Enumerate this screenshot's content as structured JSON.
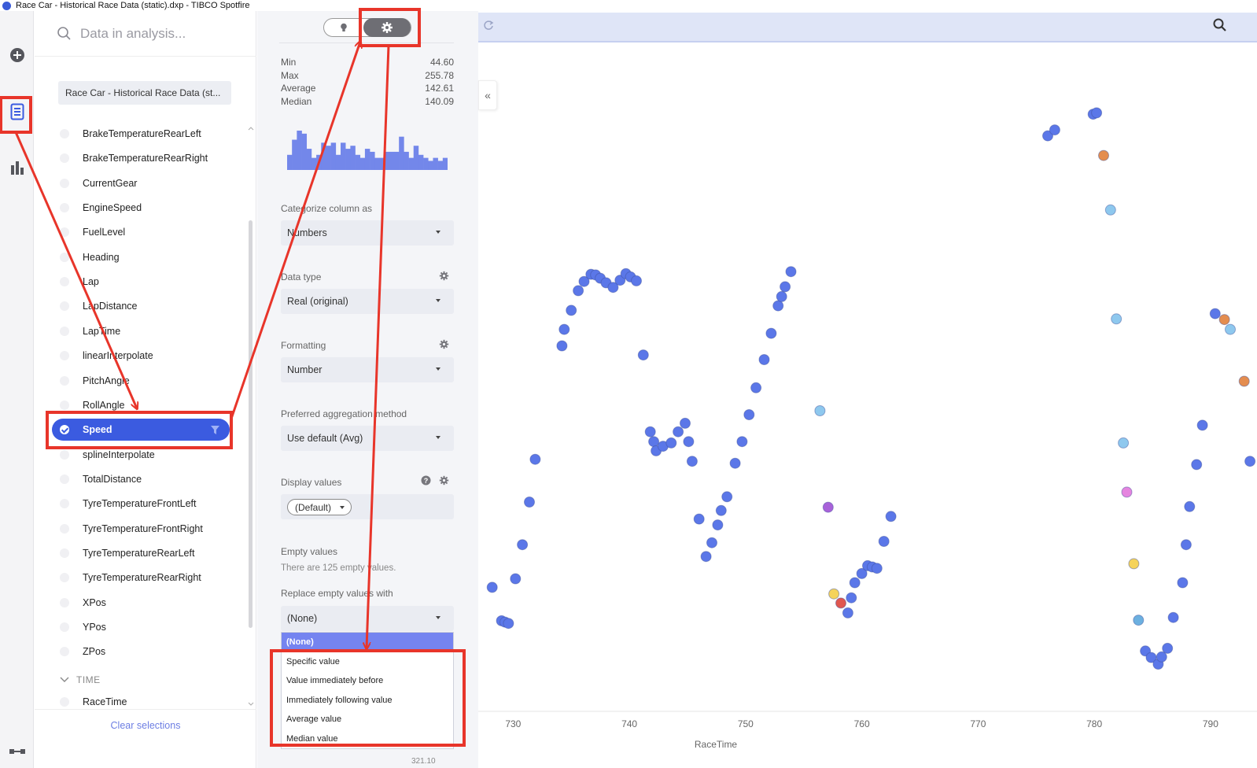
{
  "window": {
    "title": "Race Car - Historical Race Data (static).dxp - TIBCO Spotfire"
  },
  "rail": {
    "icons": [
      "add-icon",
      "data-icon",
      "visualization-icon",
      "bookmark-icon"
    ]
  },
  "data_panel": {
    "search_placeholder": "Data in analysis...",
    "data_source": "Race Car - Historical Race Data (st...",
    "columns": [
      {
        "label": "BrakeTemperatureRearLeft"
      },
      {
        "label": "BrakeTemperatureRearRight"
      },
      {
        "label": "CurrentGear"
      },
      {
        "label": "EngineSpeed"
      },
      {
        "label": "FuelLevel"
      },
      {
        "label": "Heading"
      },
      {
        "label": "Lap"
      },
      {
        "label": "LapDistance"
      },
      {
        "label": "LapTime"
      },
      {
        "label": "linearInterpolate"
      },
      {
        "label": "PitchAngle"
      },
      {
        "label": "RollAngle"
      },
      {
        "label": "Speed"
      },
      {
        "label": "splineInterpolate"
      },
      {
        "label": "TotalDistance"
      },
      {
        "label": "TyreTemperatureFrontLeft"
      },
      {
        "label": "TyreTemperatureFrontRight"
      },
      {
        "label": "TyreTemperatureRearLeft"
      },
      {
        "label": "TyreTemperatureRearRight"
      },
      {
        "label": "XPos"
      },
      {
        "label": "YPos"
      },
      {
        "label": "ZPos"
      }
    ],
    "selected_column": "Speed",
    "group_header": "TIME",
    "time_column": "RaceTime",
    "clear_selections": "Clear selections"
  },
  "settings_panel": {
    "stats": [
      {
        "label": "Min",
        "value": "44.60"
      },
      {
        "label": "Max",
        "value": "255.78"
      },
      {
        "label": "Average",
        "value": "142.61"
      },
      {
        "label": "Median",
        "value": "140.09"
      }
    ],
    "histogram_counts": [
      5,
      10,
      13,
      12,
      7,
      4,
      5,
      9,
      8,
      9,
      5,
      9,
      7,
      8,
      5,
      4,
      7,
      6,
      4,
      4,
      6,
      6,
      6,
      11,
      6,
      4,
      8,
      5,
      4,
      3,
      4,
      3,
      4
    ],
    "categorize_label": "Categorize column as",
    "categorize_value": "Numbers",
    "data_type_label": "Data type",
    "data_type_value": "Real (original)",
    "formatting_label": "Formatting",
    "formatting_value": "Number",
    "aggregation_label": "Preferred aggregation method",
    "aggregation_value": "Use default (Avg)",
    "display_values_label": "Display values",
    "display_values_value": "(Default)",
    "empty_values_label": "Empty values",
    "empty_values_note": "There are 125 empty values.",
    "replace_label": "Replace empty values with",
    "replace_value": "(None)",
    "replace_options": [
      "(None)",
      "Specific value",
      "Value immediately before",
      "Immediately following value",
      "Average value",
      "Median value"
    ],
    "bottom_partial": "321.10"
  },
  "chart_data": {
    "type": "scatter",
    "xlabel": "RaceTime",
    "ylabel": "",
    "xlim": [
      727,
      794
    ],
    "ylim": [
      0,
      100
    ],
    "xticks": [
      730,
      740,
      750,
      760,
      770,
      780,
      790
    ],
    "colors": {
      "primary": "#5b77e8",
      "lightblue": "#8ec8ee",
      "orange": "#e48d4f",
      "yellow": "#f5d35a",
      "red": "#e0574f",
      "purple": "#a862d9",
      "pink": "#e585df",
      "teal": "#6cb0e0"
    },
    "points": [
      {
        "x": 728.2,
        "y": 18.9,
        "c": "primary"
      },
      {
        "x": 729.0,
        "y": 13.8,
        "c": "primary"
      },
      {
        "x": 729.3,
        "y": 13.6,
        "c": "primary"
      },
      {
        "x": 729.6,
        "y": 13.4,
        "c": "primary"
      },
      {
        "x": 730.2,
        "y": 20.2,
        "c": "primary"
      },
      {
        "x": 730.8,
        "y": 25.4,
        "c": "primary"
      },
      {
        "x": 731.4,
        "y": 31.9,
        "c": "primary"
      },
      {
        "x": 731.9,
        "y": 38.4,
        "c": "primary"
      },
      {
        "x": 734.2,
        "y": 55.7,
        "c": "primary"
      },
      {
        "x": 734.4,
        "y": 58.2,
        "c": "primary"
      },
      {
        "x": 735.0,
        "y": 61.1,
        "c": "primary"
      },
      {
        "x": 735.6,
        "y": 64.1,
        "c": "primary"
      },
      {
        "x": 736.1,
        "y": 65.5,
        "c": "primary"
      },
      {
        "x": 736.7,
        "y": 66.6,
        "c": "primary"
      },
      {
        "x": 737.1,
        "y": 66.5,
        "c": "primary"
      },
      {
        "x": 737.5,
        "y": 66.0,
        "c": "primary"
      },
      {
        "x": 738.0,
        "y": 65.3,
        "c": "primary"
      },
      {
        "x": 738.6,
        "y": 64.6,
        "c": "primary"
      },
      {
        "x": 739.2,
        "y": 65.7,
        "c": "primary"
      },
      {
        "x": 739.7,
        "y": 66.7,
        "c": "primary"
      },
      {
        "x": 740.1,
        "y": 66.2,
        "c": "primary"
      },
      {
        "x": 740.6,
        "y": 65.6,
        "c": "primary"
      },
      {
        "x": 741.2,
        "y": 54.3,
        "c": "primary"
      },
      {
        "x": 741.8,
        "y": 42.6,
        "c": "primary"
      },
      {
        "x": 742.1,
        "y": 41.1,
        "c": "primary"
      },
      {
        "x": 742.3,
        "y": 39.7,
        "c": "primary"
      },
      {
        "x": 742.9,
        "y": 40.4,
        "c": "primary"
      },
      {
        "x": 743.6,
        "y": 40.9,
        "c": "primary"
      },
      {
        "x": 744.2,
        "y": 42.6,
        "c": "primary"
      },
      {
        "x": 744.8,
        "y": 43.9,
        "c": "primary"
      },
      {
        "x": 745.1,
        "y": 41.1,
        "c": "primary"
      },
      {
        "x": 745.4,
        "y": 38.1,
        "c": "primary"
      },
      {
        "x": 746.0,
        "y": 29.3,
        "c": "primary"
      },
      {
        "x": 746.6,
        "y": 23.6,
        "c": "primary"
      },
      {
        "x": 747.1,
        "y": 25.7,
        "c": "primary"
      },
      {
        "x": 747.6,
        "y": 28.4,
        "c": "primary"
      },
      {
        "x": 747.9,
        "y": 30.6,
        "c": "primary"
      },
      {
        "x": 748.4,
        "y": 32.7,
        "c": "primary"
      },
      {
        "x": 749.1,
        "y": 37.8,
        "c": "primary"
      },
      {
        "x": 749.7,
        "y": 41.1,
        "c": "primary"
      },
      {
        "x": 750.3,
        "y": 45.2,
        "c": "primary"
      },
      {
        "x": 750.9,
        "y": 49.3,
        "c": "primary"
      },
      {
        "x": 751.6,
        "y": 53.6,
        "c": "primary"
      },
      {
        "x": 752.2,
        "y": 57.6,
        "c": "primary"
      },
      {
        "x": 752.8,
        "y": 61.8,
        "c": "primary"
      },
      {
        "x": 753.1,
        "y": 63.2,
        "c": "primary"
      },
      {
        "x": 753.4,
        "y": 64.7,
        "c": "primary"
      },
      {
        "x": 753.9,
        "y": 67.0,
        "c": "primary"
      },
      {
        "x": 756.4,
        "y": 45.8,
        "c": "lightblue"
      },
      {
        "x": 757.1,
        "y": 31.1,
        "c": "purple"
      },
      {
        "x": 757.6,
        "y": 17.9,
        "c": "yellow"
      },
      {
        "x": 758.2,
        "y": 16.5,
        "c": "red"
      },
      {
        "x": 758.8,
        "y": 15.0,
        "c": "primary"
      },
      {
        "x": 759.1,
        "y": 17.3,
        "c": "primary"
      },
      {
        "x": 759.4,
        "y": 19.6,
        "c": "primary"
      },
      {
        "x": 760.0,
        "y": 21.0,
        "c": "primary"
      },
      {
        "x": 760.5,
        "y": 22.2,
        "c": "primary"
      },
      {
        "x": 760.9,
        "y": 22.0,
        "c": "primary"
      },
      {
        "x": 761.3,
        "y": 21.8,
        "c": "primary"
      },
      {
        "x": 761.9,
        "y": 25.9,
        "c": "primary"
      },
      {
        "x": 762.5,
        "y": 29.7,
        "c": "primary"
      },
      {
        "x": 776.0,
        "y": 87.7,
        "c": "primary"
      },
      {
        "x": 776.6,
        "y": 88.6,
        "c": "primary"
      },
      {
        "x": 779.9,
        "y": 91.0,
        "c": "primary"
      },
      {
        "x": 780.2,
        "y": 91.2,
        "c": "primary"
      },
      {
        "x": 780.8,
        "y": 84.7,
        "c": "orange"
      },
      {
        "x": 781.4,
        "y": 76.4,
        "c": "lightblue"
      },
      {
        "x": 781.9,
        "y": 59.8,
        "c": "lightblue"
      },
      {
        "x": 782.5,
        "y": 40.9,
        "c": "lightblue"
      },
      {
        "x": 782.8,
        "y": 33.4,
        "c": "pink"
      },
      {
        "x": 783.4,
        "y": 22.5,
        "c": "yellow"
      },
      {
        "x": 783.8,
        "y": 13.9,
        "c": "teal"
      },
      {
        "x": 784.4,
        "y": 9.2,
        "c": "primary"
      },
      {
        "x": 784.9,
        "y": 8.2,
        "c": "primary"
      },
      {
        "x": 785.5,
        "y": 7.2,
        "c": "primary"
      },
      {
        "x": 785.8,
        "y": 8.3,
        "c": "primary"
      },
      {
        "x": 786.3,
        "y": 9.6,
        "c": "primary"
      },
      {
        "x": 786.8,
        "y": 14.3,
        "c": "primary"
      },
      {
        "x": 787.6,
        "y": 19.6,
        "c": "primary"
      },
      {
        "x": 787.9,
        "y": 25.4,
        "c": "primary"
      },
      {
        "x": 788.2,
        "y": 31.2,
        "c": "primary"
      },
      {
        "x": 788.8,
        "y": 37.6,
        "c": "primary"
      },
      {
        "x": 789.3,
        "y": 43.6,
        "c": "primary"
      },
      {
        "x": 790.4,
        "y": 60.6,
        "c": "primary"
      },
      {
        "x": 791.2,
        "y": 59.7,
        "c": "orange"
      },
      {
        "x": 791.7,
        "y": 58.2,
        "c": "lightblue"
      },
      {
        "x": 792.9,
        "y": 50.3,
        "c": "orange"
      },
      {
        "x": 793.4,
        "y": 38.1,
        "c": "primary"
      }
    ]
  }
}
